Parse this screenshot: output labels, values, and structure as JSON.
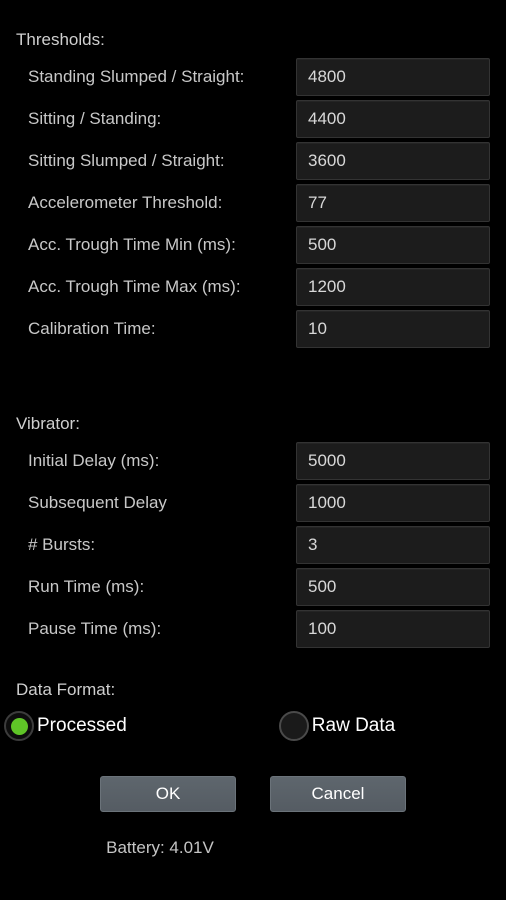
{
  "sections": [
    {
      "id": "thresholds",
      "title": "Thresholds:",
      "rows": [
        {
          "label": "Standing Slumped / Straight:",
          "value": "4800",
          "name": "standing-slumped-straight"
        },
        {
          "label": "Sitting / Standing:",
          "value": "4400",
          "name": "sitting-standing"
        },
        {
          "label": "Sitting Slumped / Straight:",
          "value": "3600",
          "name": "sitting-slumped-straight"
        },
        {
          "label": "Accelerometer Threshold:",
          "value": "77",
          "name": "accelerometer-threshold"
        },
        {
          "label": "Acc. Trough Time Min (ms):",
          "value": "500",
          "name": "acc-trough-time-min"
        },
        {
          "label": "Acc. Trough Time Max (ms):",
          "value": "1200",
          "name": "acc-trough-time-max"
        },
        {
          "label": "Calibration Time:",
          "value": "10",
          "name": "calibration-time"
        }
      ]
    },
    {
      "id": "vibrator",
      "title": "Vibrator:",
      "rows": [
        {
          "label": "Initial Delay (ms):",
          "value": "5000",
          "name": "initial-delay"
        },
        {
          "label": "Subsequent Delay",
          "value": "1000",
          "name": "subsequent-delay"
        },
        {
          "label": "# Bursts:",
          "value": "3",
          "name": "num-bursts"
        },
        {
          "label": "Run Time (ms):",
          "value": "500",
          "name": "run-time"
        },
        {
          "label": "Pause Time (ms):",
          "value": "100",
          "name": "pause-time"
        }
      ]
    }
  ],
  "data_format": {
    "title": "Data Format:",
    "options": [
      {
        "label": "Processed",
        "selected": true,
        "name": "processed"
      },
      {
        "label": "Raw Data",
        "selected": false,
        "name": "raw-data"
      }
    ]
  },
  "buttons": {
    "ok": "OK",
    "cancel": "Cancel"
  },
  "status": {
    "battery": "Battery: 4.01V"
  },
  "colors": {
    "background": "#000000",
    "label": "#c8c8c8",
    "field_background": "#1c1c1c",
    "field_border": "#333333",
    "radio_selected": "#5fc527",
    "button_background": "#5e666d",
    "button_text": "#ffffff"
  }
}
